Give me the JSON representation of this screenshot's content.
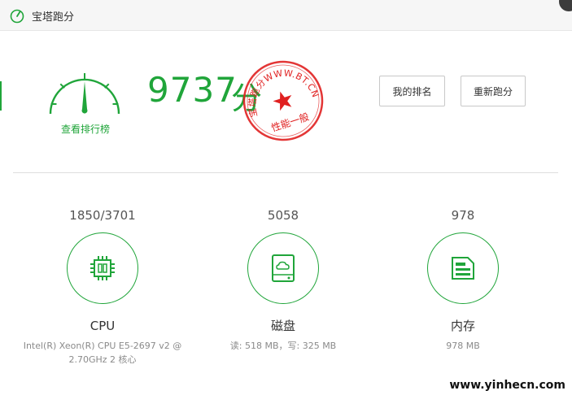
{
  "window": {
    "title": "宝塔跑分"
  },
  "summary": {
    "rank_link": "查看排行榜",
    "score": "9737",
    "score_unit": "分",
    "stamp_text_top": "宝塔跑分WWW.BT.CN",
    "stamp_text_bottom": "性能一般",
    "my_rank_button": "我的排名",
    "rerun_button": "重新跑分"
  },
  "metrics": [
    {
      "value": "1850/3701",
      "name": "CPU",
      "desc_line1": "Intel(R) Xeon(R) CPU E5-2697 v2 @",
      "desc_line2": "2.70GHz 2 核心",
      "icon": "cpu-chip-icon"
    },
    {
      "value": "5058",
      "name": "磁盘",
      "desc_line1": "读: 518 MB，写: 325 MB",
      "desc_line2": "",
      "icon": "disk-cloud-icon"
    },
    {
      "value": "978",
      "name": "内存",
      "desc_line1": "978 MB",
      "desc_line2": "",
      "icon": "memory-module-icon"
    }
  ],
  "watermark": "www.yinhecn.com",
  "colors": {
    "accent": "#20a53a",
    "stamp": "#e02020"
  }
}
